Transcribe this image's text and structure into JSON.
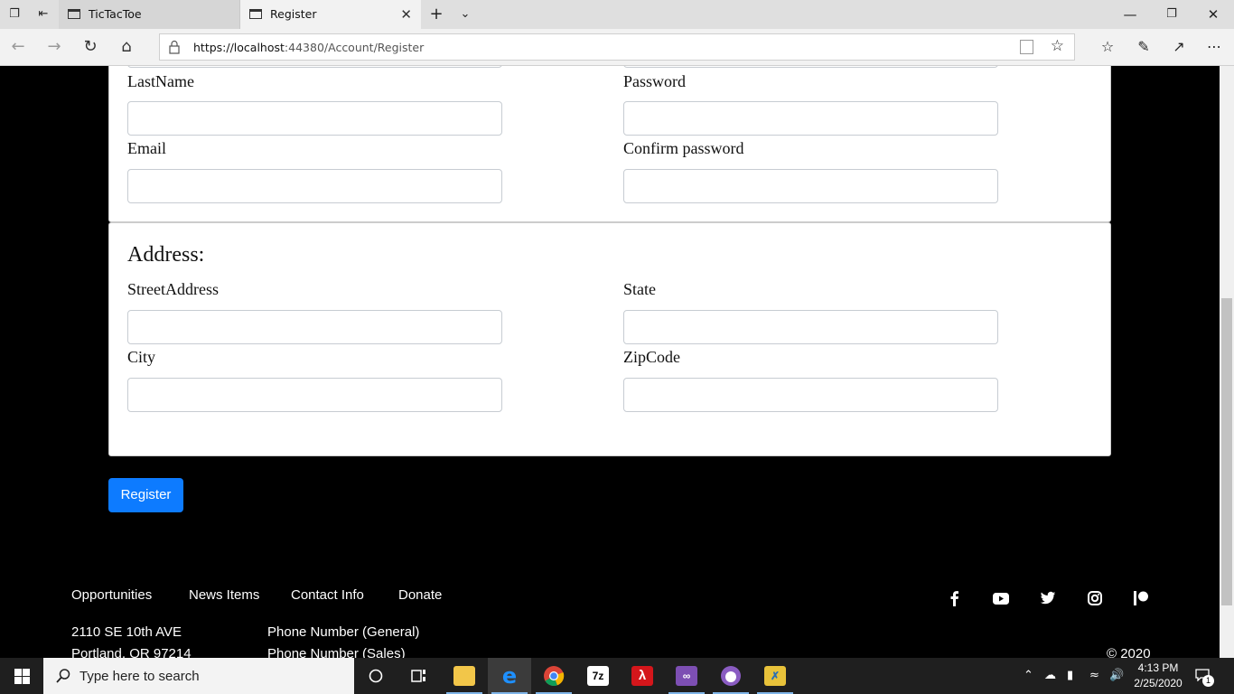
{
  "browser": {
    "tabs": [
      {
        "label": "TicTacToe"
      },
      {
        "label": "Register"
      }
    ],
    "url_host": "https://localhost",
    "url_path": ":44380/Account/Register"
  },
  "form": {
    "account": {
      "lastname_label": "LastName",
      "password_label": "Password",
      "email_label": "Email",
      "confirm_password_label": "Confirm password",
      "lastname_value": "",
      "password_value": "",
      "email_value": "",
      "confirm_password_value": ""
    },
    "address": {
      "title": "Address:",
      "street_label": "StreetAddress",
      "state_label": "State",
      "city_label": "City",
      "zip_label": "ZipCode",
      "street_value": "",
      "state_value": "",
      "city_value": "",
      "zip_value": ""
    },
    "register_label": "Register"
  },
  "footer": {
    "links": [
      "Opportunities",
      "News Items",
      "Contact Info",
      "Donate"
    ],
    "address_line1": "2110 SE 10th AVE",
    "address_line2": "Portland, OR 97214",
    "phone_general": "Phone Number (General)",
    "phone_sales": "Phone Number (Sales)",
    "copyright": "© 2020",
    "social": [
      "facebook-icon",
      "youtube-icon",
      "twitter-icon",
      "instagram-icon",
      "patreon-icon"
    ]
  },
  "taskbar": {
    "search_placeholder": "Type here to search",
    "time": "4:13 PM",
    "date": "2/25/2020",
    "notification_count": "1",
    "apps": [
      "task-view",
      "file-explorer",
      "edge",
      "chrome",
      "7zip",
      "acrobat",
      "visual-studio",
      "github-desktop",
      "app-8"
    ]
  },
  "colors": {
    "accent": "#0d7bff",
    "page_bg": "#000000",
    "card_bg": "#ffffff"
  }
}
